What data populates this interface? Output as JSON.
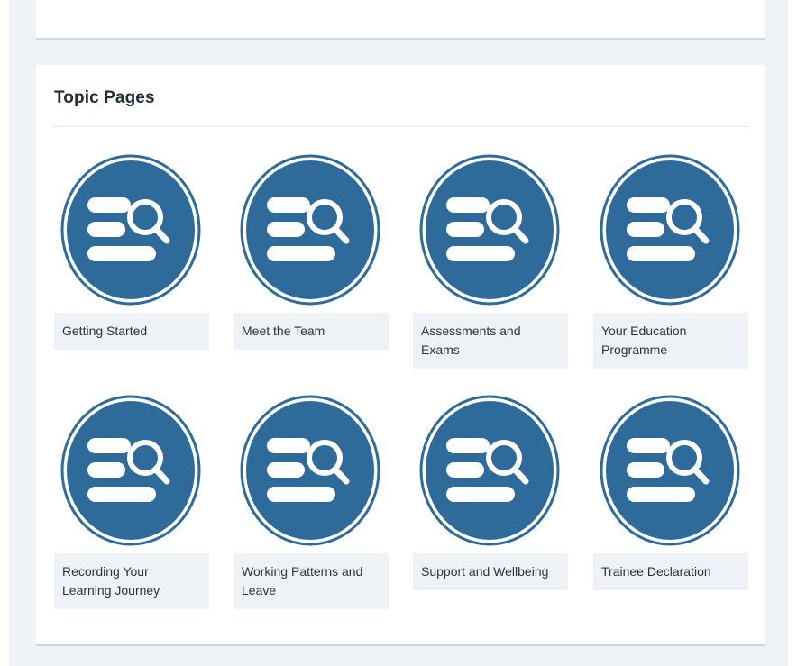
{
  "section": {
    "title": "Topic Pages"
  },
  "tiles": [
    {
      "label": "Getting Started",
      "icon": "book-search-icon"
    },
    {
      "label": "Meet the Team",
      "icon": "book-search-icon"
    },
    {
      "label": "Assessments and Exams",
      "icon": "book-search-icon"
    },
    {
      "label": "Your Education Programme",
      "icon": "book-search-icon"
    },
    {
      "label": "Recording Your Learning Journey",
      "icon": "book-search-icon"
    },
    {
      "label": "Working Patterns and Leave",
      "icon": "book-search-icon"
    },
    {
      "label": "Support and Wellbeing",
      "icon": "book-search-icon"
    },
    {
      "label": "Trainee Declaration",
      "icon": "book-search-icon"
    }
  ],
  "colors": {
    "icon_fill": "#2e6b9a",
    "page_background": "#eef1f6",
    "label_background": "#eef1f6"
  }
}
